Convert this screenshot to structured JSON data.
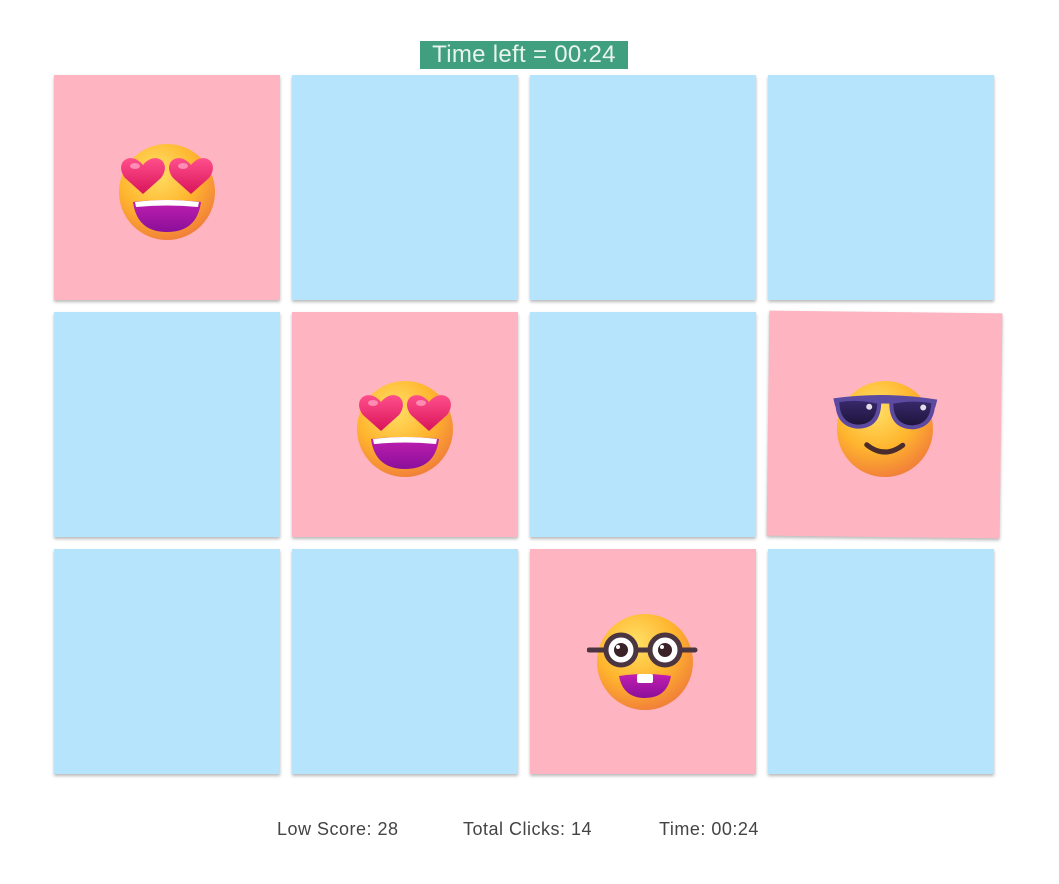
{
  "timer": {
    "text": "Time left = 00:24",
    "background": "#3f9f7f"
  },
  "board": {
    "rows": 3,
    "columns": 4,
    "card_back_color": "#b6e4fc",
    "card_face_color": "#feb4c1",
    "cards": [
      {
        "face_up": true,
        "emoji": "heart-eyes-face-icon"
      },
      {
        "face_up": false,
        "emoji": null
      },
      {
        "face_up": false,
        "emoji": null
      },
      {
        "face_up": false,
        "emoji": null
      },
      {
        "face_up": false,
        "emoji": null
      },
      {
        "face_up": true,
        "emoji": "heart-eyes-face-icon"
      },
      {
        "face_up": false,
        "emoji": null
      },
      {
        "face_up": true,
        "emoji": "sunglasses-face-icon"
      },
      {
        "face_up": false,
        "emoji": null
      },
      {
        "face_up": false,
        "emoji": null
      },
      {
        "face_up": true,
        "emoji": "nerd-glasses-face-icon"
      },
      {
        "face_up": false,
        "emoji": null
      }
    ]
  },
  "stats": {
    "low_score": "Low Score: 28",
    "total_clicks": "Total Clicks: 14",
    "time": "Time: 00:24"
  }
}
